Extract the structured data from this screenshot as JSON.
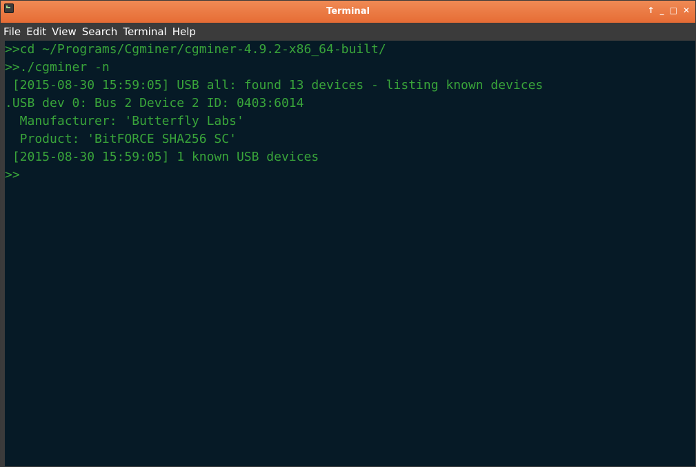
{
  "window": {
    "title": "Terminal",
    "controls": {
      "up": "↑",
      "minimize": "_",
      "maximize": "□",
      "close": "✕"
    },
    "icon": "terminal-app-icon"
  },
  "menu": {
    "items": [
      "File",
      "Edit",
      "View",
      "Search",
      "Terminal",
      "Help"
    ]
  },
  "terminal": {
    "lines": [
      ">>cd ~/Programs/Cgminer/cgminer-4.9.2-x86_64-built/",
      ">>./cgminer -n",
      " [2015-08-30 15:59:05] USB all: found 13 devices - listing known devices",
      ".USB dev 0: Bus 2 Device 2 ID: 0403:6014",
      "  Manufacturer: 'Butterfly Labs'",
      "  Product: 'BitFORCE SHA256 SC'",
      " [2015-08-30 15:59:05] 1 known USB devices",
      ">>"
    ],
    "colors": {
      "background": "#061a26",
      "text": "#39a43a"
    }
  },
  "colors": {
    "titlebar": "#e97a44",
    "menubar": "#3b3b3b"
  }
}
